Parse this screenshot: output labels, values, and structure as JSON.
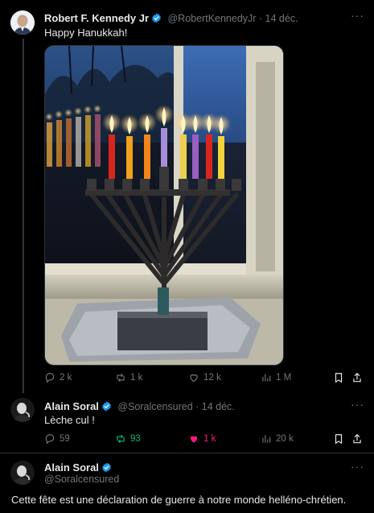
{
  "colors": {
    "background": "#000000",
    "text": "#e7e9ea",
    "muted": "#71767b",
    "verified_blue": "#1d9bf0",
    "repost_green": "#00ba7c",
    "like_pink": "#f91880"
  },
  "tweet1": {
    "author_name": "Robert F. Kennedy Jr",
    "handle_time": "@RobertKennedyJr · 14 déc.",
    "text": "Happy Hanukkah!",
    "actions": {
      "replies": "2 k",
      "reposts": "1 k",
      "likes": "12 k",
      "views": "1 M"
    },
    "icons": [
      "reply-icon",
      "repost-icon",
      "like-icon",
      "views-icon",
      "bookmark-icon",
      "share-icon",
      "more-icon"
    ]
  },
  "tweet2": {
    "author_name": "Alain Soral",
    "handle_time": "@Soralcensured · 14 déc.",
    "text": "Lèche cul !",
    "actions": {
      "replies": "59",
      "reposts": "93",
      "likes": "1 k",
      "views": "20 k"
    }
  },
  "tweet3": {
    "author_name": "Alain Soral",
    "handle": "@Soralcensured",
    "text": "Cette fête est une déclaration de guerre à notre monde helléno-chrétien."
  }
}
